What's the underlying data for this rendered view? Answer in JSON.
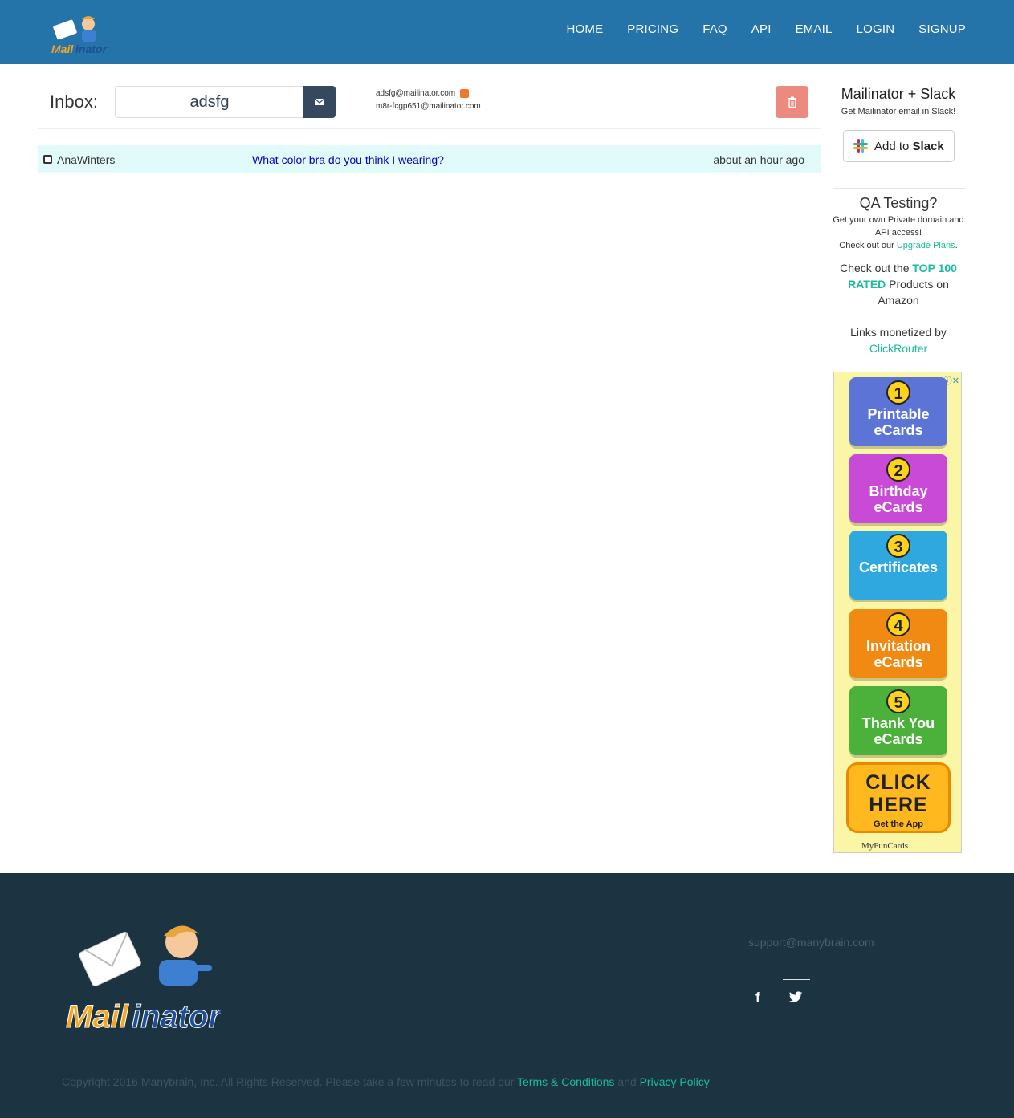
{
  "nav": {
    "logo_text": "Mailinator",
    "items": [
      "HOME",
      "PRICING",
      "FAQ",
      "API",
      "EMAIL",
      "LOGIN",
      "SIGNUP"
    ]
  },
  "inbox": {
    "label": "Inbox:",
    "value": "adsfg",
    "addresses": [
      "adsfg@mailinator.com",
      "m8r-fcgp651@mailinator.com"
    ]
  },
  "messages": [
    {
      "from": "AnaWinters",
      "subject": "What color bra do you think I wearing?",
      "time": "about an hour ago"
    }
  ],
  "sidebar": {
    "slack_title": "Mailinator + Slack",
    "slack_sub": "Get Mailinator email in Slack!",
    "slack_btn_pre": "Add to",
    "slack_btn_bold": "Slack",
    "qa_title": "QA Testing?",
    "qa_line1": "Get your own Private domain and API access!",
    "qa_line2_pre": "Check out our",
    "qa_line2_link": "Upgrade Plans",
    "qa_line2_post": ".",
    "amazon_pre": "Check out the",
    "amazon_link": "TOP 100 RATED",
    "amazon_post": "Products on Amazon",
    "monet_pre": "Links monetized by",
    "monet_link": "ClickRouter"
  },
  "ad": {
    "cards": [
      {
        "num": "1",
        "text": "Printable eCards",
        "color": "#5b74d6"
      },
      {
        "num": "2",
        "text": "Birthday eCards",
        "color": "#c94ad6"
      },
      {
        "num": "3",
        "text": "Certificates",
        "color": "#2fa8e0"
      },
      {
        "num": "4",
        "text": "Invitation eCards",
        "color": "#f08a12"
      },
      {
        "num": "5",
        "text": "Thank You eCards",
        "color": "#4bb13a"
      }
    ],
    "click_big": "CLICK HERE",
    "click_small": "Get the App",
    "brand": "MyFunCards"
  },
  "footer": {
    "support": "support@manybrain.com",
    "copyright": "Copyright 2016 Manybrain, Inc. All Rights Reserved. Please take a few minutes to read our",
    "terms": "Terms & Conditions",
    "and": "and",
    "privacy": "Privacy Policy"
  }
}
